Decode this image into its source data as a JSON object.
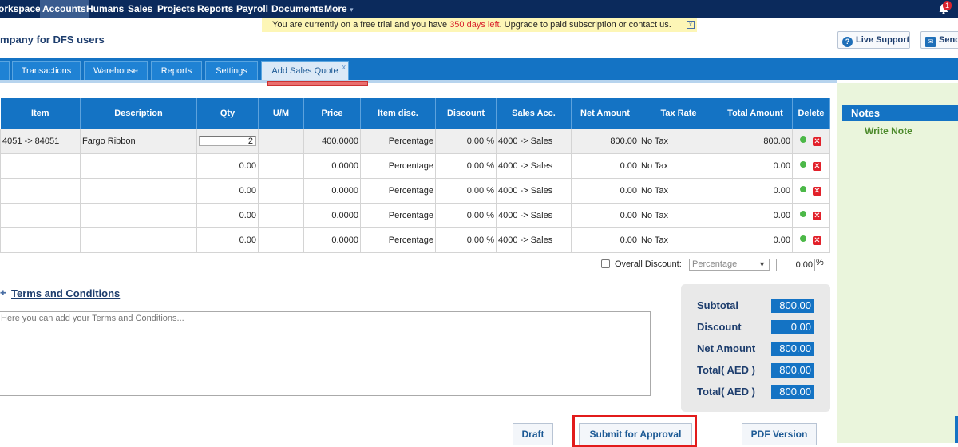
{
  "topnav": {
    "items": [
      "orkspace",
      "Accounts",
      "Humans",
      "Sales",
      "Projects",
      "Reports",
      "Payroll",
      "Documents",
      "More"
    ],
    "more_arrow": "▾",
    "notification_count": "1"
  },
  "trial": {
    "prefix": "You are currently on a free trial and you have ",
    "days": "350 days left",
    "middle": ". Upgrade to paid subscription or contact us.",
    "close": "x"
  },
  "header": {
    "company": "mpany for DFS users",
    "live_support": "Live Support",
    "send": "Send"
  },
  "tabs": [
    "Transactions",
    "Warehouse",
    "Reports",
    "Settings",
    "Add Sales Quote"
  ],
  "tab_close": "x",
  "grid": {
    "columns": [
      "Item",
      "Description",
      "Qty",
      "U/M",
      "Price",
      "Item disc.",
      "Discount",
      "Sales Acc.",
      "Net Amount",
      "Tax Rate",
      "Total Amount",
      "Delete"
    ],
    "rows": [
      {
        "item": "4051 -> 84051",
        "description": "Fargo Ribbon",
        "qty": "2",
        "um": "",
        "price": "400.0000",
        "item_disc": "Percentage",
        "discount": "0.00 %",
        "sales_acc": "4000 -> Sales",
        "net": "800.00",
        "tax": "No Tax",
        "total": "800.00"
      },
      {
        "item": "",
        "description": "",
        "qty": "0.00",
        "um": "",
        "price": "0.0000",
        "item_disc": "Percentage",
        "discount": "0.00 %",
        "sales_acc": "4000 -> Sales",
        "net": "0.00",
        "tax": "No Tax",
        "total": "0.00"
      },
      {
        "item": "",
        "description": "",
        "qty": "0.00",
        "um": "",
        "price": "0.0000",
        "item_disc": "Percentage",
        "discount": "0.00 %",
        "sales_acc": "4000 -> Sales",
        "net": "0.00",
        "tax": "No Tax",
        "total": "0.00"
      },
      {
        "item": "",
        "description": "",
        "qty": "0.00",
        "um": "",
        "price": "0.0000",
        "item_disc": "Percentage",
        "discount": "0.00 %",
        "sales_acc": "4000 -> Sales",
        "net": "0.00",
        "tax": "No Tax",
        "total": "0.00"
      },
      {
        "item": "",
        "description": "",
        "qty": "0.00",
        "um": "",
        "price": "0.0000",
        "item_disc": "Percentage",
        "discount": "0.00 %",
        "sales_acc": "4000 -> Sales",
        "net": "0.00",
        "tax": "No Tax",
        "total": "0.00"
      }
    ]
  },
  "overall_discount": {
    "label": "Overall Discount:",
    "type": "Percentage",
    "value": "0.00",
    "unit": "%"
  },
  "terms": {
    "title": "Terms and Conditions",
    "placeholder": "Here you can add your Terms and Conditions..."
  },
  "summary": [
    {
      "label": "Subtotal",
      "value": "800.00"
    },
    {
      "label": "Discount",
      "value": "0.00"
    },
    {
      "label": "Net Amount",
      "value": "800.00"
    },
    {
      "label": "Total( AED )",
      "value": "800.00"
    },
    {
      "label": "Total( AED )",
      "value": "800.00"
    }
  ],
  "actions": {
    "draft": "Draft",
    "submit": "Submit for Approval",
    "pdf": "PDF Version"
  },
  "notes": {
    "title": "Notes",
    "write": "Write Note"
  },
  "colors": {
    "nav": "#0b2a5c",
    "accent": "#1473c4",
    "highlight": "#e21b1b",
    "notes_bg": "#eaf5dc"
  }
}
